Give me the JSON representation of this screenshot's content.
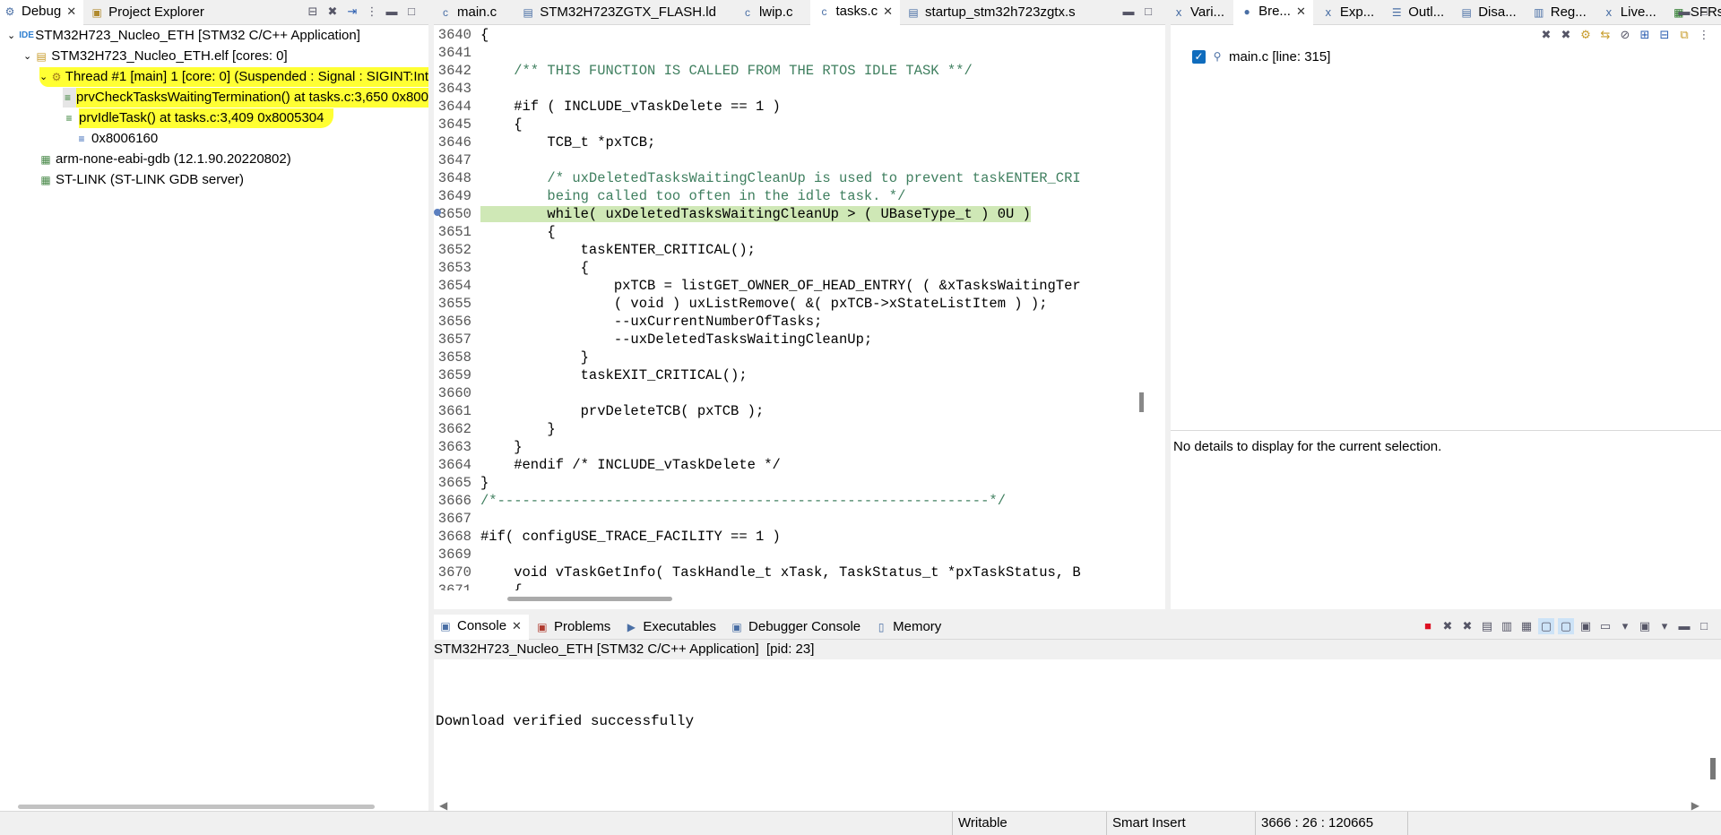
{
  "debug_view": {
    "tabs": [
      {
        "label": "Debug",
        "active": true
      },
      {
        "label": "Project Explorer",
        "active": false
      }
    ],
    "tree": [
      {
        "label": "STM32H723_Nucleo_ETH [STM32 C/C++ Application]",
        "icon": "ide-icon"
      },
      {
        "label": "STM32H723_Nucleo_ETH.elf [cores: 0]",
        "icon": "process-icon"
      },
      {
        "label": "Thread #1 [main] 1 [core: 0] (Suspended : Signal : SIGINT:Int",
        "icon": "thread-icon"
      },
      {
        "label": "prvCheckTasksWaitingTermination() at tasks.c:3,650 0x800",
        "icon": "stack-frame-icon"
      },
      {
        "label": "prvIdleTask() at tasks.c:3,409 0x8005304",
        "icon": "stack-frame-icon"
      },
      {
        "label": "0x8006160",
        "icon": "stack-frame-icon"
      },
      {
        "label": "arm-none-eabi-gdb (12.1.90.20220802)",
        "icon": "gdb-icon"
      },
      {
        "label": "ST-LINK (ST-LINK GDB server)",
        "icon": "gdb-icon"
      }
    ]
  },
  "editor": {
    "tabs": [
      {
        "label": "main.c",
        "active": false
      },
      {
        "label": "STM32H723ZGTX_FLASH.ld",
        "active": false
      },
      {
        "label": "lwip.c",
        "active": false
      },
      {
        "label": "tasks.c",
        "active": true
      },
      {
        "label": "startup_stm32h723zgtx.s",
        "active": false
      }
    ],
    "lines": [
      {
        "n": "3640",
        "code": "{"
      },
      {
        "n": "3641",
        "code": ""
      },
      {
        "n": "3642",
        "code": "    /** THIS FUNCTION IS CALLED FROM THE RTOS IDLE TASK **/"
      },
      {
        "n": "3643",
        "code": ""
      },
      {
        "n": "3644",
        "code": "    #if ( INCLUDE_vTaskDelete == 1 )"
      },
      {
        "n": "3645",
        "code": "    {"
      },
      {
        "n": "3646",
        "code": "        TCB_t *pxTCB;"
      },
      {
        "n": "3647",
        "code": ""
      },
      {
        "n": "3648",
        "code": "        /* uxDeletedTasksWaitingCleanUp is used to prevent taskENTER_CRI"
      },
      {
        "n": "3649",
        "code": "        being called too often in the idle task. */"
      },
      {
        "n": "3650",
        "code": "        while( uxDeletedTasksWaitingCleanUp > ( UBaseType_t ) 0U )"
      },
      {
        "n": "3651",
        "code": "        {"
      },
      {
        "n": "3652",
        "code": "            taskENTER_CRITICAL();"
      },
      {
        "n": "3653",
        "code": "            {"
      },
      {
        "n": "3654",
        "code": "                pxTCB = listGET_OWNER_OF_HEAD_ENTRY( ( &xTasksWaitingTer"
      },
      {
        "n": "3655",
        "code": "                ( void ) uxListRemove( &( pxTCB->xStateListItem ) );"
      },
      {
        "n": "3656",
        "code": "                --uxCurrentNumberOfTasks;"
      },
      {
        "n": "3657",
        "code": "                --uxDeletedTasksWaitingCleanUp;"
      },
      {
        "n": "3658",
        "code": "            }"
      },
      {
        "n": "3659",
        "code": "            taskEXIT_CRITICAL();"
      },
      {
        "n": "3660",
        "code": ""
      },
      {
        "n": "3661",
        "code": "            prvDeleteTCB( pxTCB );"
      },
      {
        "n": "3662",
        "code": "        }"
      },
      {
        "n": "3663",
        "code": "    }"
      },
      {
        "n": "3664",
        "code": "    #endif /* INCLUDE_vTaskDelete */"
      },
      {
        "n": "3665",
        "code": "}"
      },
      {
        "n": "3666",
        "code": "/*-----------------------------------------------------------*/"
      },
      {
        "n": "3667",
        "code": ""
      },
      {
        "n": "3668",
        "code": "#if( configUSE_TRACE_FACILITY == 1 )"
      },
      {
        "n": "3669",
        "code": ""
      },
      {
        "n": "3670",
        "code": "    void vTaskGetInfo( TaskHandle_t xTask, TaskStatus_t *pxTaskStatus, B"
      },
      {
        "n": "3671",
        "code": "    {"
      }
    ]
  },
  "right_view": {
    "tabs": [
      {
        "label": "Vari...",
        "active": false
      },
      {
        "label": "Bre...",
        "active": true
      },
      {
        "label": "Exp...",
        "active": false
      },
      {
        "label": "Outl...",
        "active": false
      },
      {
        "label": "Disa...",
        "active": false
      },
      {
        "label": "Reg...",
        "active": false
      },
      {
        "label": "Live...",
        "active": false
      },
      {
        "label": "SFRs",
        "active": false
      }
    ],
    "breakpoint": "main.c [line: 315]",
    "details": "No details to display for the current selection."
  },
  "console_view": {
    "tabs": [
      {
        "label": "Console",
        "active": true
      },
      {
        "label": "Problems",
        "active": false
      },
      {
        "label": "Executables",
        "active": false
      },
      {
        "label": "Debugger Console",
        "active": false
      },
      {
        "label": "Memory",
        "active": false
      }
    ],
    "header": "STM32H723_Nucleo_ETH [STM32 C/C++ Application]  [pid: 23]",
    "output": "Download verified successfully"
  },
  "status_bar": {
    "writable": "Writable",
    "insert_mode": "Smart Insert",
    "position": "3666 : 26 : 120665"
  }
}
